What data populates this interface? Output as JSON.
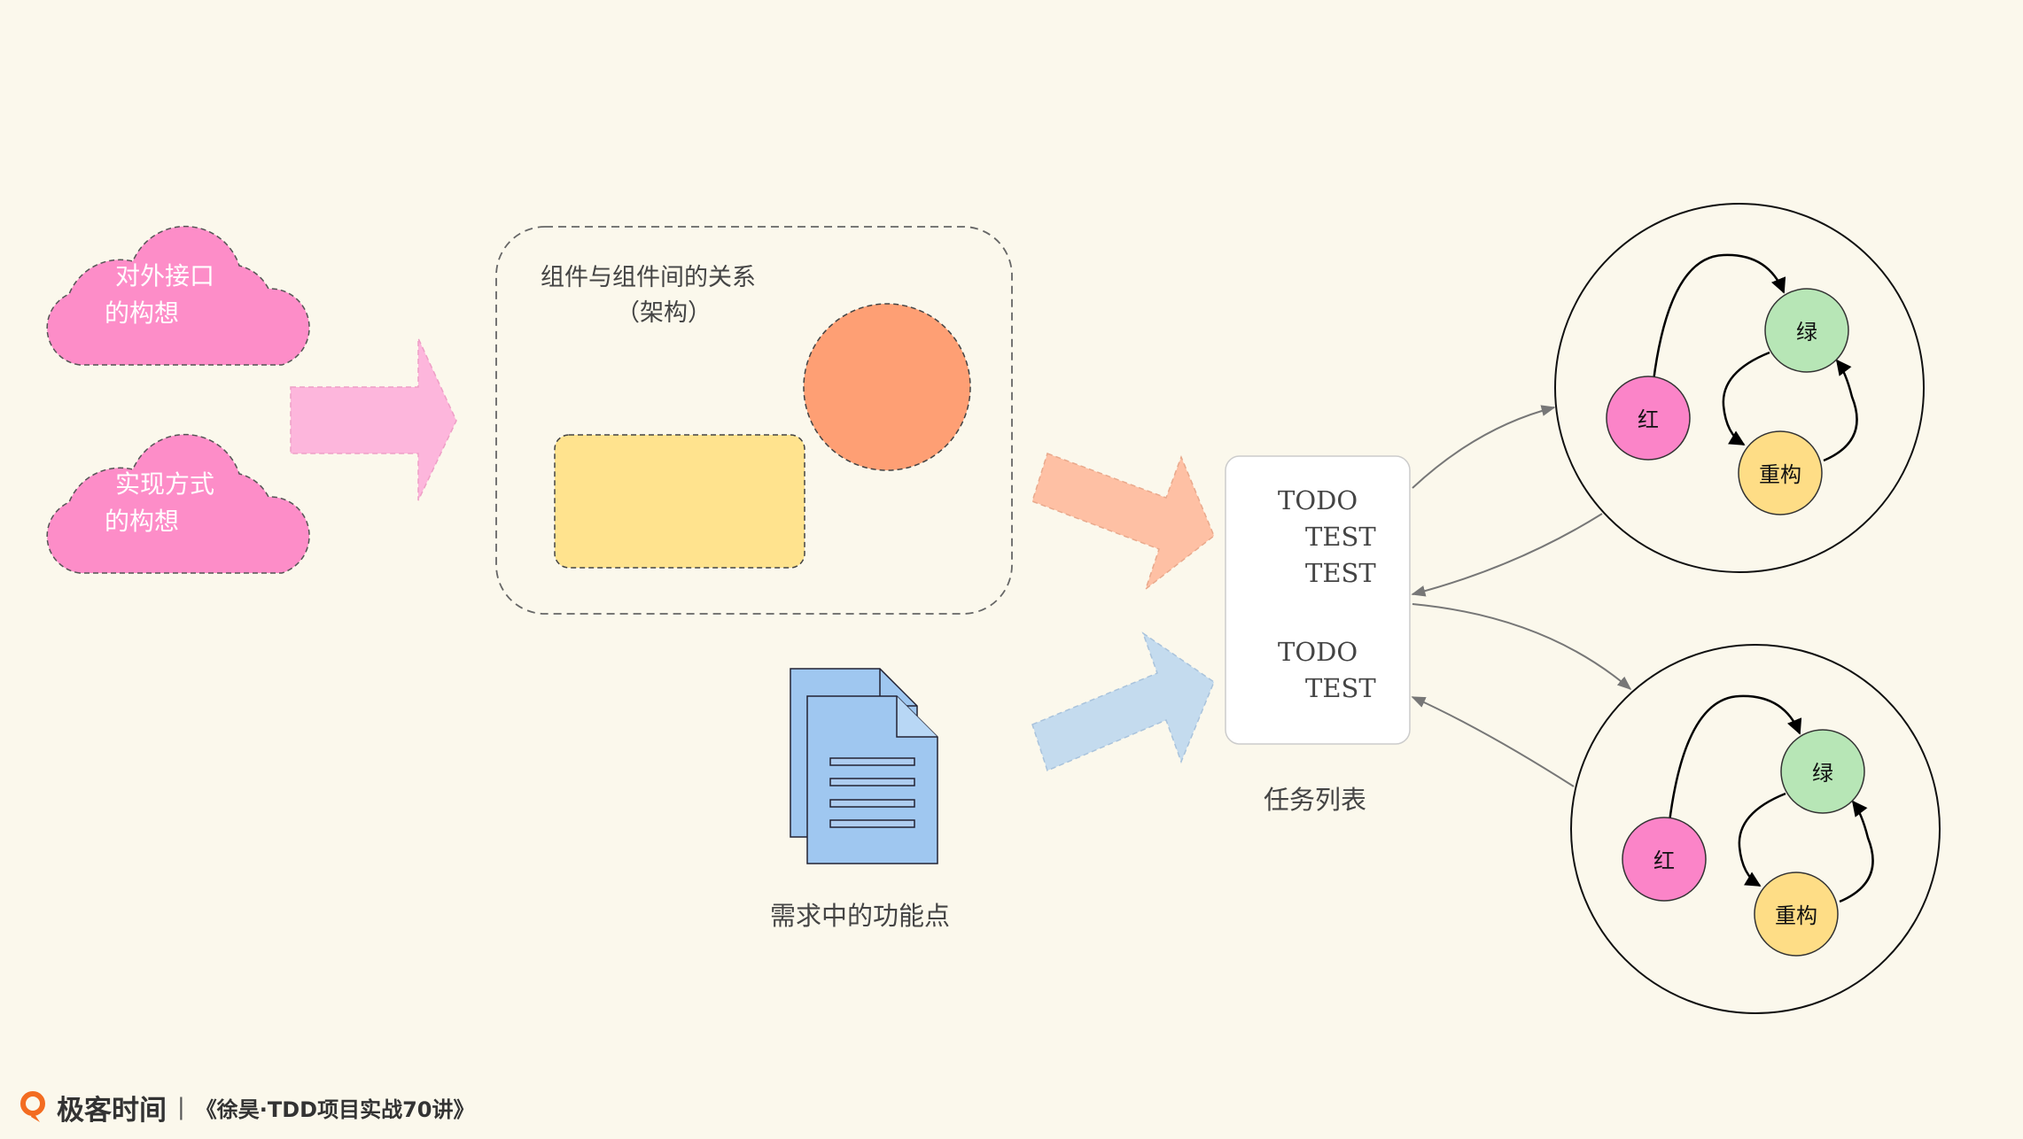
{
  "clouds": {
    "interface": {
      "line1": "对外接口",
      "line2": "的构想"
    },
    "implementation": {
      "line1": "实现方式",
      "line2": "的构想"
    }
  },
  "architecture": {
    "title": "组件与组件间的关系",
    "subtitle": "（架构）"
  },
  "requirements_label": "需求中的功能点",
  "task_list": {
    "label": "任务列表",
    "groups": [
      {
        "todo": "TODO",
        "tests": [
          "TEST",
          "TEST"
        ]
      },
      {
        "todo": "TODO",
        "tests": [
          "TEST"
        ]
      }
    ]
  },
  "cycles": [
    {
      "red": "红",
      "green": "绿",
      "refactor": "重构"
    },
    {
      "red": "红",
      "green": "绿",
      "refactor": "重构"
    }
  ],
  "colors": {
    "background": "#fbf8ec",
    "cloud": "#fd8dc8",
    "pink_arrow": "#fdb6dc",
    "orange_arrow": "#fec0a4",
    "blue_arrow": "#c4dbee",
    "circle_orange": "#fe9f74",
    "rect_yellow": "#ffe38e",
    "doc_blue": "#9fc7f0",
    "red_node": "#fb84c8",
    "green_node": "#b7e6b6",
    "refactor_node": "#fedd86"
  },
  "footer": {
    "brand": "极客时间",
    "separator": "|",
    "course": "《徐昊·TDD项目实战70讲》"
  }
}
